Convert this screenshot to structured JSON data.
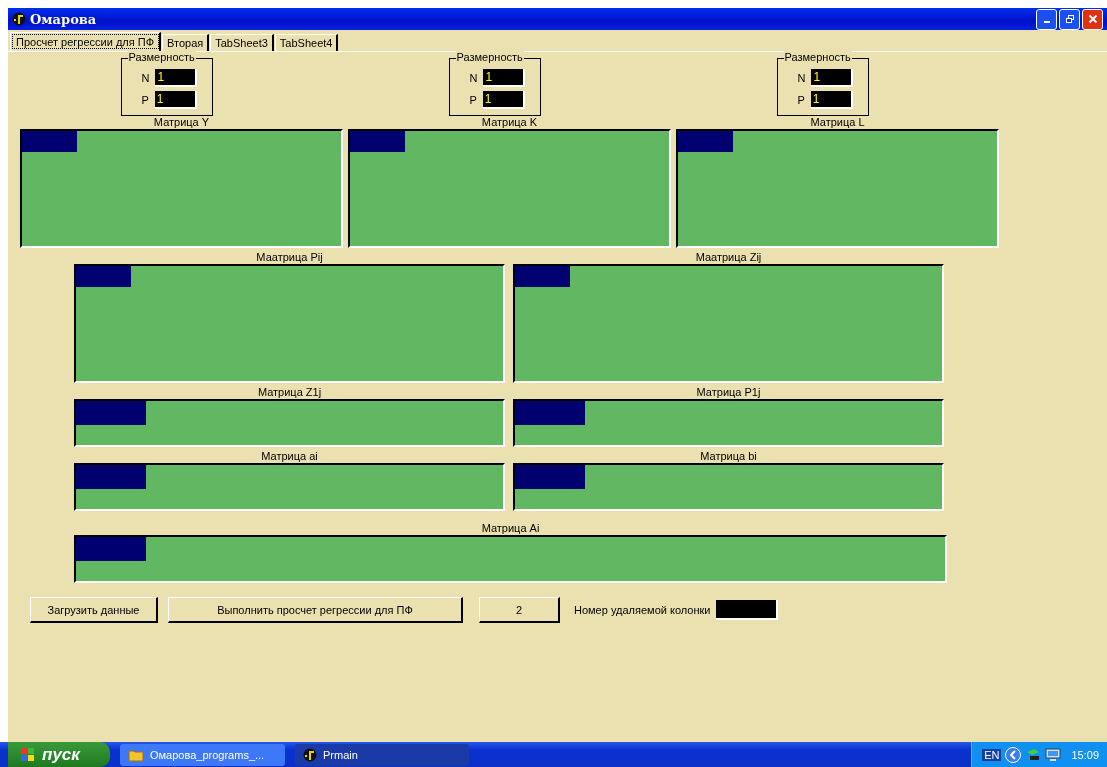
{
  "window": {
    "title": "Омарова"
  },
  "tabs": [
    {
      "label": "Просчет регрессии для ПФ",
      "selected": true
    },
    {
      "label": "Вторая",
      "selected": false
    },
    {
      "label": "TabSheet3",
      "selected": false
    },
    {
      "label": "TabSheet4",
      "selected": false
    }
  ],
  "top_columns": [
    {
      "group_title": "Размерность",
      "fields": [
        {
          "label": "N",
          "value": "1"
        },
        {
          "label": "P",
          "value": "1"
        }
      ],
      "matrix_label": "Матрица Y"
    },
    {
      "group_title": "Размерность",
      "fields": [
        {
          "label": "N",
          "value": "1"
        },
        {
          "label": "P",
          "value": "1"
        }
      ],
      "matrix_label": "Матрица K"
    },
    {
      "group_title": "Размерность",
      "fields": [
        {
          "label": "N",
          "value": "1"
        },
        {
          "label": "P",
          "value": "1"
        }
      ],
      "matrix_label": "Матрица L"
    }
  ],
  "matrix_rows": [
    {
      "kind": "tall",
      "matrices": [
        "Маатрица Pij",
        "Маатрица Zij"
      ]
    },
    {
      "kind": "short",
      "matrices": [
        "Матрица Z1j",
        "Матрица P1j"
      ]
    },
    {
      "kind": "short",
      "matrices": [
        "Матрица ai",
        "Матрица bi"
      ]
    },
    {
      "kind": "wide",
      "matrices": [
        "Матрица Ai"
      ]
    }
  ],
  "buttons": [
    "Загрузить данные",
    "Выполнить просчет регрессии для ПФ",
    "2"
  ],
  "column_field": {
    "label": "Номер удаляемой колонки"
  },
  "taskbar": {
    "start": "пуск",
    "tasks": [
      {
        "label": "Омарова_programs_...",
        "kind": "folder",
        "selected": false
      },
      {
        "label": "Prmain",
        "kind": "app",
        "selected": true
      }
    ],
    "language": "EN",
    "time": "15:09"
  }
}
